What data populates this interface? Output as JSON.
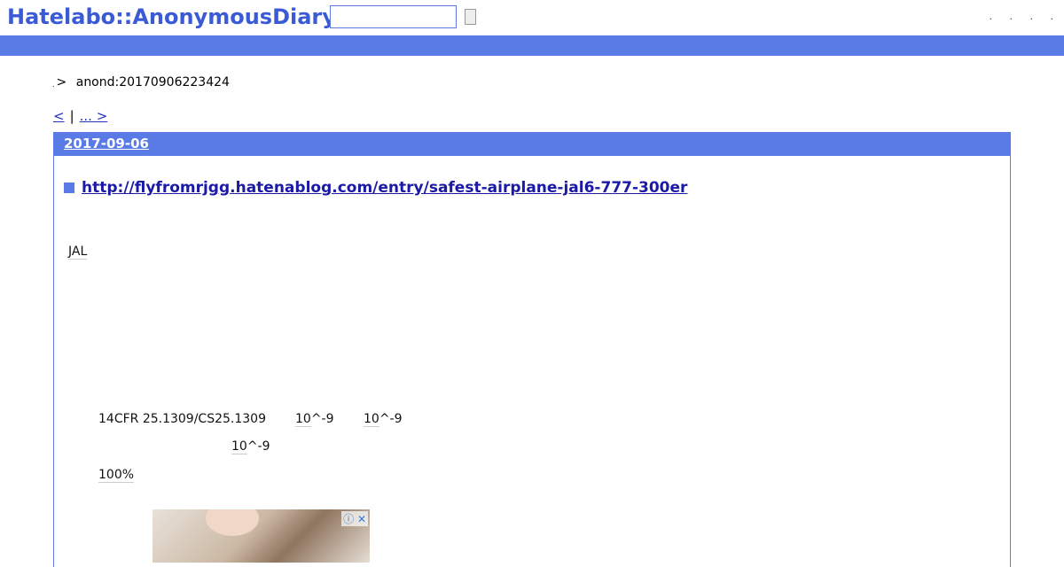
{
  "header": {
    "logo": "Hatelabo::AnonymousDiary",
    "search": {
      "value": "",
      "placeholder": ""
    },
    "top_links": [
      ".",
      ".",
      ".",
      "."
    ]
  },
  "breadcrumb": {
    "dot": ".",
    "sep": ">",
    "current": "anond:20170906223424"
  },
  "pager": {
    "prev": "<",
    "separator": "|",
    "next": "... >"
  },
  "day": {
    "date": "2017-09-06",
    "entry": {
      "title": "http://flyfromrjgg.hatenablog.com/entry/safest-airplane-jal6-777-300er",
      "paragraphs": {
        "p1": "JAL",
        "line1_a": "14CFR 25.1309/CS25.1309",
        "line1_b_kw": "10",
        "line1_b_rest": "^-9",
        "line1_c_kw": "10",
        "line1_c_rest": "^-9",
        "line2_kw": "10",
        "line2_rest": "^-9",
        "line3_kw": "100%"
      }
    }
  },
  "ad": {
    "icons": "ⓘ ✕"
  }
}
